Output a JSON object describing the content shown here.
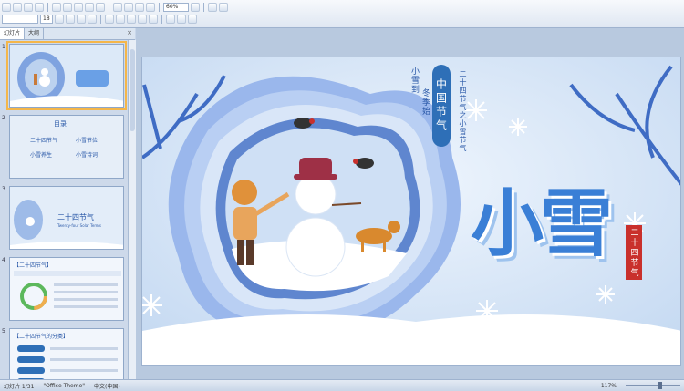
{
  "toolbar": {
    "font_size_value": "18",
    "zoom_value": "60%"
  },
  "panel": {
    "tabs": [
      "幻灯片",
      "大纲"
    ],
    "active_tab_index": 0
  },
  "thumbnails": [
    {
      "number": "1",
      "title": "小雪",
      "selected": true
    },
    {
      "number": "2",
      "title": "目录",
      "items": [
        "二十四节气",
        "小雪节俭",
        "小雪养生",
        "小雪诗词"
      ]
    },
    {
      "number": "3",
      "title": "二十四节气",
      "subtitle": "Twenty-four Solar Terms"
    },
    {
      "number": "4",
      "title": "【二十四节气】"
    },
    {
      "number": "5",
      "title": "【二十四节气的分类】"
    }
  ],
  "slide": {
    "seal_text": "中国节气",
    "vertical_caption": "二十四节气之小雪节气",
    "poem_col1": "小雪到",
    "poem_col2": "冬季始",
    "big_title": "小雪",
    "red_seal": "二十四节气"
  },
  "status": {
    "slide_info": "幻灯片 1/31",
    "theme": "\"Office Theme\"",
    "language": "中文(中国)",
    "zoom": "117%"
  },
  "colors": {
    "accent": "#2e6fb7",
    "title_blue": "#3a7fd6",
    "seal_red": "#c9302c",
    "selection": "#f4b64a"
  }
}
